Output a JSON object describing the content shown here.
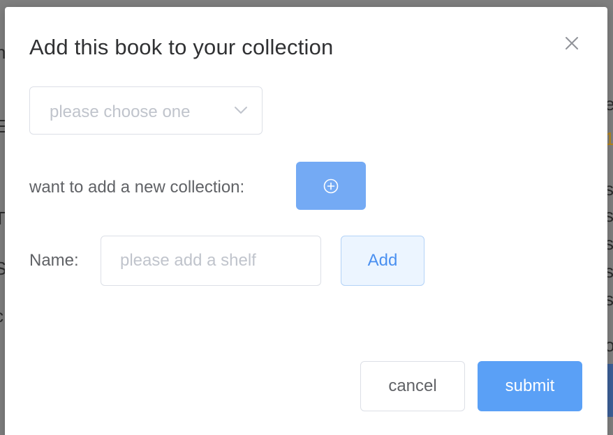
{
  "dialog": {
    "title": "Add this book to your collection",
    "close_icon": "close-icon"
  },
  "collection_select": {
    "placeholder": "please choose one",
    "icon": "chevron-down-icon"
  },
  "new_collection": {
    "label": "want to add a new collection:",
    "button_icon": "plus-circle-icon"
  },
  "shelf": {
    "label": "Name:",
    "value": "",
    "placeholder": "please add a shelf",
    "add_label": "Add"
  },
  "footer": {
    "cancel_label": "cancel",
    "submit_label": "submit"
  },
  "colors": {
    "primary": "#5aa0f6",
    "primary_light": "#74aaf4",
    "plain_bg": "#ecf5ff",
    "overlay": "#7f7f7f"
  }
}
